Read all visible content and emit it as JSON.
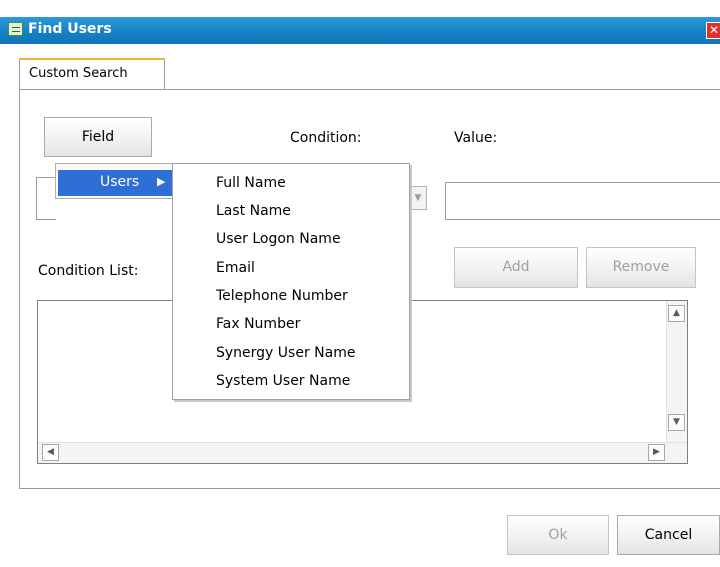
{
  "window": {
    "title": "Find Users",
    "close_glyph": "✕"
  },
  "tabs": [
    {
      "label": "Custom Search",
      "active": true
    }
  ],
  "search": {
    "field_button": "Field",
    "condition_label": "Condition:",
    "value_label": "Value:",
    "value_input": "",
    "condition_list_label": "Condition List:",
    "add_button": "Add",
    "remove_button": "Remove"
  },
  "field_menu": {
    "category": "Users",
    "items": [
      "Full Name",
      "Last Name",
      "User Logon Name",
      "Email",
      "Telephone Number",
      "Fax Number",
      "Synergy User Name",
      "System User Name"
    ]
  },
  "footer": {
    "ok_button": "Ok",
    "cancel_button": "Cancel"
  },
  "colors": {
    "titlebar": "#1683c6",
    "menu_highlight": "#2e6fd6",
    "active_tab_accent": "#f2b233"
  },
  "icons": {
    "window_icon": "find-users-window-icon",
    "submenu_arrow": "triangle-right-icon",
    "close": "close-icon"
  }
}
